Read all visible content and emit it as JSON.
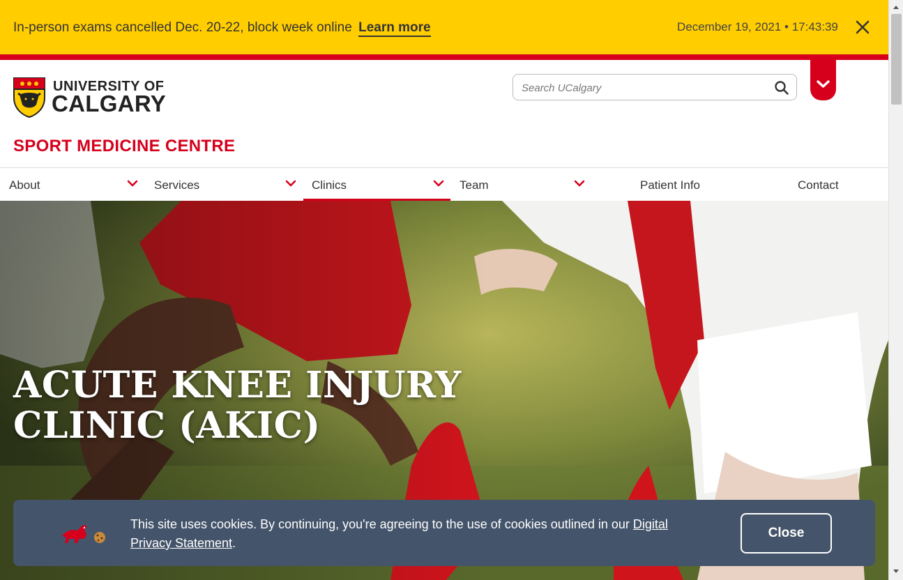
{
  "alert": {
    "message": "In-person exams cancelled Dec. 20-22, block week online",
    "link_label": "Learn more",
    "datetime": "December 19, 2021 • 17:43:39"
  },
  "header": {
    "logo_line1": "UNIVERSITY OF",
    "logo_line2": "CALGARY",
    "search_placeholder": "Search UCalgary",
    "unit_title": "SPORT MEDICINE CENTRE"
  },
  "nav": {
    "items": [
      {
        "label": "About",
        "has_dropdown": true
      },
      {
        "label": "Services",
        "has_dropdown": true
      },
      {
        "label": "Clinics",
        "has_dropdown": true,
        "active": true
      },
      {
        "label": "Team",
        "has_dropdown": true
      },
      {
        "label": "Patient Info",
        "has_dropdown": false
      },
      {
        "label": "Contact",
        "has_dropdown": false
      }
    ]
  },
  "hero": {
    "title_line1": "ACUTE KNEE INJURY",
    "title_line2": "CLINIC (AKIC)"
  },
  "cookie": {
    "text": "This site uses cookies. By continuing, you're agreeing to the use of cookies outlined in our ",
    "link_label": "Digital Privacy Statement",
    "text_end": ".",
    "close_label": "Close"
  },
  "colors": {
    "brand_red": "#d6001c",
    "alert_yellow": "#ffcd00",
    "cookie_bg": "#44546a"
  }
}
